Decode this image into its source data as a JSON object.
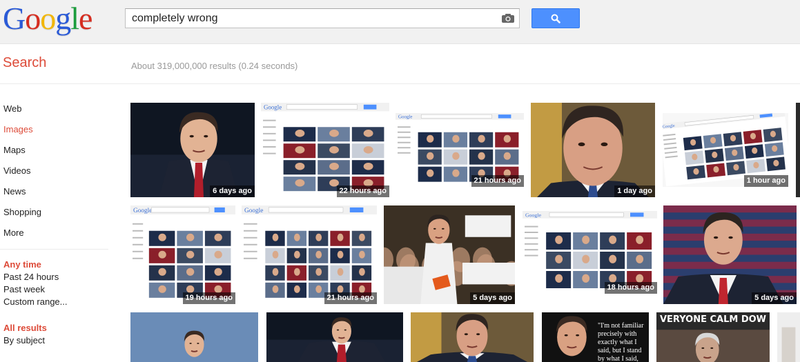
{
  "header": {
    "logo_letters": [
      "G",
      "o",
      "o",
      "g",
      "l",
      "e"
    ],
    "logo_colors": [
      "#2a5ad7",
      "#d62d20",
      "#f2b705",
      "#2a5ad7",
      "#1b9d3c",
      "#d62d20"
    ],
    "search": {
      "query": "completely wrong",
      "camera_icon": "camera-icon",
      "button_icon": "magnifier-icon"
    }
  },
  "page": {
    "title": "Search",
    "result_stats": "About 319,000,000 results (0.24 seconds)"
  },
  "sidebar": {
    "items": [
      {
        "label": "Web",
        "active": false
      },
      {
        "label": "Images",
        "active": true
      },
      {
        "label": "Maps",
        "active": false
      },
      {
        "label": "Videos",
        "active": false
      },
      {
        "label": "News",
        "active": false
      },
      {
        "label": "Shopping",
        "active": false
      },
      {
        "label": "More",
        "active": false
      }
    ],
    "time_filter": {
      "heading": "Any time",
      "options": [
        "Past 24 hours",
        "Past week",
        "Custom range..."
      ]
    },
    "results_filter": {
      "heading": "All results",
      "options": [
        "By subject"
      ]
    }
  },
  "results": {
    "images": [
      {
        "label": "6 days ago",
        "kind": "portrait-dark"
      },
      {
        "label": "22 hours ago",
        "kind": "screenshot"
      },
      {
        "label": "21 hours ago",
        "kind": "screenshot-small"
      },
      {
        "label": "1 day ago",
        "kind": "portrait-close"
      },
      {
        "label": "1 hour ago",
        "kind": "screenshot-tilted"
      },
      {
        "label": "19 hours ago",
        "kind": "screenshot"
      },
      {
        "label": "21 hours ago",
        "kind": "screenshot-wide"
      },
      {
        "label": "5 days ago",
        "kind": "rally"
      },
      {
        "label": "18 hours ago",
        "kind": "screenshot-small"
      },
      {
        "label": "5 days ago",
        "kind": "portrait-flag"
      },
      {
        "label": "",
        "kind": "portrait-speech"
      },
      {
        "label": "",
        "kind": "portrait-dark"
      },
      {
        "label": "",
        "kind": "portrait-close"
      },
      {
        "label": "",
        "kind": "quote-meme"
      },
      {
        "label": "",
        "kind": "caption-meme"
      },
      {
        "label": "",
        "kind": "portrait-partial"
      }
    ],
    "quote_meme_text": [
      "\"I'm not familiar",
      "precisely with",
      "exactly what I",
      "said, but I stand",
      "by what I said,"
    ],
    "caption_meme_text": "VERYONE CALM DOW"
  }
}
